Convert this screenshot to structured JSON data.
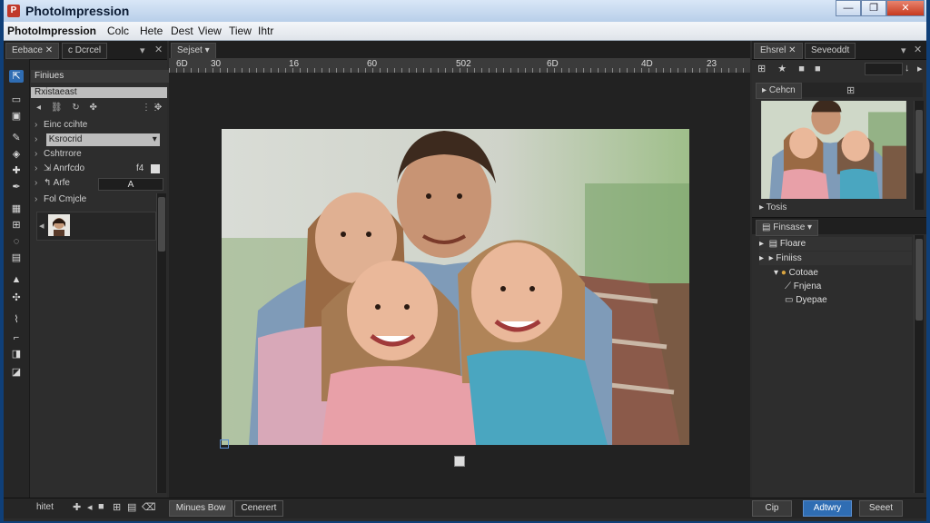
{
  "window": {
    "title": "PhotoImpression"
  },
  "menu": [
    "Colc",
    "Hete",
    "Dest",
    "View",
    "Tiew",
    "Ihtr"
  ],
  "left_panel": {
    "tab_primary": "Eebace",
    "tab_secondary": "c Dcrcel",
    "header": "Finiues",
    "section": "Rxistaeast",
    "rows": [
      "Einc ccihte",
      "Ksrocrid",
      "Cshtrrore",
      "Anrfcdo",
      "Arfe",
      "Fol Cmjcle"
    ],
    "row_value_1": "f4",
    "row_value_2": "A"
  },
  "center": {
    "tab": "Sejset",
    "ruler": [
      "6D",
      "30",
      "16",
      "60",
      "502",
      "6D",
      "4D",
      "23"
    ],
    "image_label": "Family portrait of a father with three smiling daughters"
  },
  "right_panel": {
    "tab_primary": "Ehsrel",
    "tab_secondary": "Seveoddt",
    "preview_tab": "Cehcn",
    "preview_footer": "Tosis",
    "layers_tab": "Finsase",
    "layers": [
      "Floare",
      "Finiiss",
      "Cotoae",
      "Fnjena",
      "Dyepae"
    ]
  },
  "bottom": {
    "left_label": "hitet",
    "center_tab_primary": "Minues Bow",
    "center_tab_secondary": "Cenerert",
    "btn_cancel": "Cip",
    "btn_primary": "Adtwry",
    "btn_reset": "Seeet"
  },
  "colors": {
    "accent": "#2f6db3",
    "panel": "#2d2d2d",
    "canvas": "#222222",
    "titlebar": "#c9dbef"
  }
}
